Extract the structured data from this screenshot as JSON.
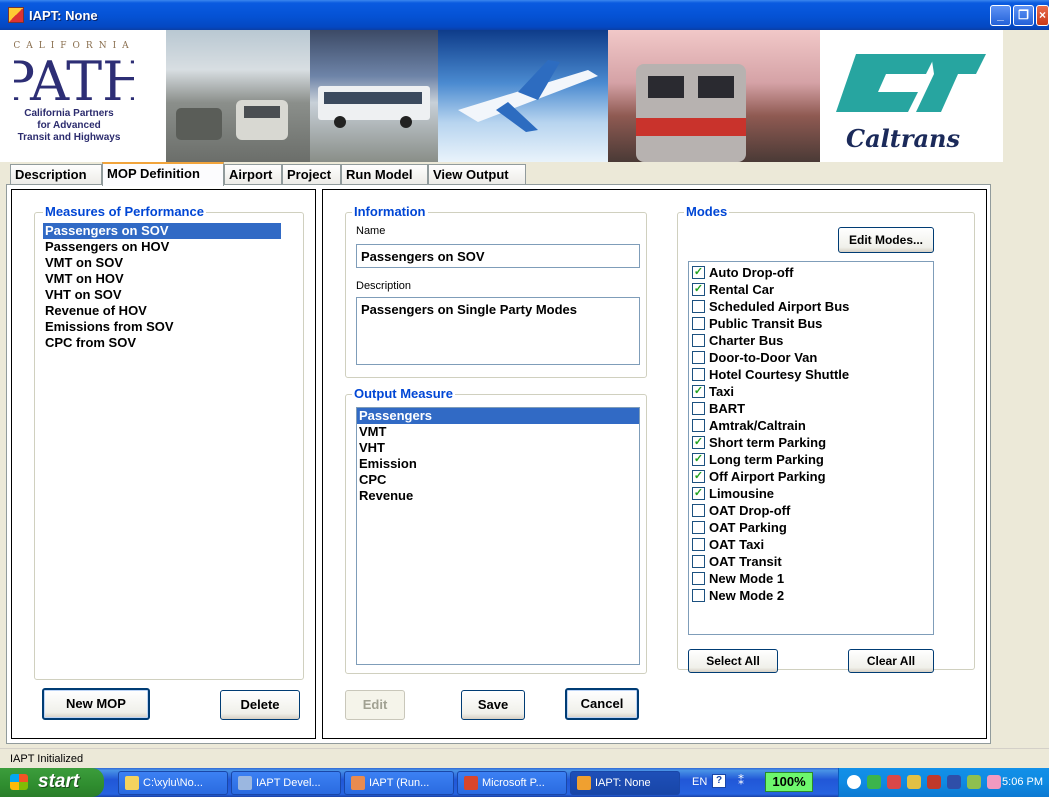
{
  "window": {
    "title": "IAPT: None"
  },
  "banner": {
    "path_logo_letters": "CALIFORNIA",
    "path_logo_word": "PATH",
    "path_caption": [
      "California Partners",
      "for Advanced",
      "Transit and Highways"
    ],
    "caltrans_wordmark": "Caltrans"
  },
  "tabs": [
    {
      "label": "Description"
    },
    {
      "label": "MOP Definition"
    },
    {
      "label": "Airport"
    },
    {
      "label": "Project"
    },
    {
      "label": "Run Model"
    },
    {
      "label": "View Output"
    }
  ],
  "mop": {
    "legend": "Measures of Performance",
    "items": [
      "Passengers on SOV",
      "Passengers on HOV",
      "VMT on SOV",
      "VMT on HOV",
      "VHT on SOV",
      "Revenue of HOV",
      "Emissions from SOV",
      "CPC from SOV"
    ],
    "selected_index": 0,
    "new_button": "New MOP",
    "delete_button": "Delete"
  },
  "information": {
    "legend": "Information",
    "name_label": "Name",
    "name_value": "Passengers on SOV",
    "description_label": "Description",
    "description_value": "Passengers on Single Party Modes"
  },
  "output_measure": {
    "legend": "Output Measure",
    "items": [
      "Passengers",
      "VMT",
      "VHT",
      "Emission",
      "CPC",
      "Revenue"
    ],
    "selected_index": 0
  },
  "actions": {
    "edit": "Edit",
    "save": "Save",
    "cancel": "Cancel"
  },
  "modes": {
    "legend": "Modes",
    "edit_button": "Edit Modes...",
    "select_all": "Select All",
    "clear_all": "Clear All",
    "items": [
      {
        "label": "Auto Drop-off",
        "checked": true
      },
      {
        "label": "Rental Car",
        "checked": true
      },
      {
        "label": "Scheduled Airport Bus",
        "checked": false
      },
      {
        "label": "Public Transit Bus",
        "checked": false
      },
      {
        "label": "Charter Bus",
        "checked": false
      },
      {
        "label": "Door-to-Door Van",
        "checked": false
      },
      {
        "label": "Hotel Courtesy Shuttle",
        "checked": false
      },
      {
        "label": "Taxi",
        "checked": true
      },
      {
        "label": "BART",
        "checked": false
      },
      {
        "label": "Amtrak/Caltrain",
        "checked": false
      },
      {
        "label": "Short term Parking",
        "checked": true
      },
      {
        "label": "Long term Parking",
        "checked": true
      },
      {
        "label": "Off Airport Parking",
        "checked": true
      },
      {
        "label": "Limousine",
        "checked": true
      },
      {
        "label": "OAT Drop-off",
        "checked": false
      },
      {
        "label": "OAT Parking",
        "checked": false
      },
      {
        "label": "OAT Taxi",
        "checked": false
      },
      {
        "label": "OAT Transit",
        "checked": false
      },
      {
        "label": "New Mode 1",
        "checked": false
      },
      {
        "label": "New Mode 2",
        "checked": false
      }
    ]
  },
  "status": {
    "text": "IAPT Initialized"
  },
  "taskbar": {
    "start": "start",
    "tasks": [
      {
        "label": "C:\\xylu\\No...",
        "icon_color": "#f4d35e"
      },
      {
        "label": "IAPT Devel...",
        "icon_color": "#9bb7e0"
      },
      {
        "label": "IAPT (Run...",
        "icon_color": "#e98b4f"
      },
      {
        "label": "Microsoft P...",
        "icon_color": "#d9462c"
      },
      {
        "label": "IAPT: None",
        "icon_color": "#f0a030"
      }
    ],
    "language": "EN",
    "zoom": "100%",
    "clock": "5:06 PM"
  }
}
